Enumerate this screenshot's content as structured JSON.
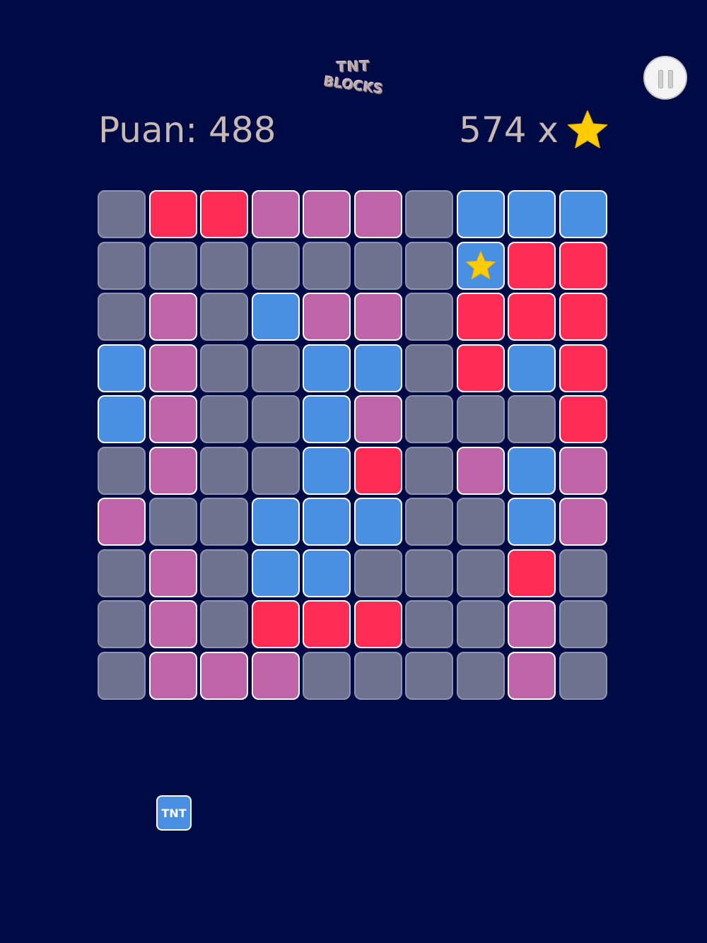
{
  "logo": {
    "line1": "TNT",
    "line2": "BLOCKS"
  },
  "score": {
    "label": "Puan: 488"
  },
  "stars": {
    "count_label": "574 x"
  },
  "board": {
    "rows": [
      [
        "gray",
        "red",
        "red",
        "purple",
        "purple",
        "purple",
        "gray",
        "blue",
        "blue",
        "blue"
      ],
      [
        "gray",
        "gray",
        "gray",
        "gray",
        "gray",
        "gray",
        "gray",
        "blue-star",
        "red",
        "red"
      ],
      [
        "gray",
        "purple",
        "gray",
        "blue",
        "purple",
        "purple",
        "gray",
        "red",
        "red",
        "red"
      ],
      [
        "blue",
        "purple",
        "gray",
        "gray",
        "blue",
        "blue",
        "gray",
        "red",
        "blue",
        "red"
      ],
      [
        "blue",
        "purple",
        "gray",
        "gray",
        "blue",
        "purple",
        "gray",
        "gray",
        "gray",
        "red"
      ],
      [
        "gray",
        "purple",
        "gray",
        "gray",
        "blue",
        "red",
        "gray",
        "purple",
        "blue",
        "purple"
      ],
      [
        "purple",
        "gray",
        "gray",
        "blue",
        "blue",
        "blue",
        "gray",
        "gray",
        "blue",
        "purple"
      ],
      [
        "gray",
        "purple",
        "gray",
        "blue",
        "blue",
        "gray",
        "gray",
        "gray",
        "red",
        "gray"
      ],
      [
        "gray",
        "purple",
        "gray",
        "red",
        "red",
        "red",
        "gray",
        "gray",
        "purple",
        "gray"
      ],
      [
        "gray",
        "purple",
        "purple",
        "purple",
        "gray",
        "gray",
        "gray",
        "gray",
        "purple",
        "gray"
      ]
    ]
  },
  "tnt": {
    "label": "TNT"
  },
  "colors": {
    "background": "#000b45",
    "red": "#ff2d55",
    "purple": "#c064aa",
    "blue": "#4a90e2",
    "gray": "#6e728f",
    "star": "#ffcc00"
  },
  "icons": {
    "pause": "pause-icon",
    "star": "star-icon"
  }
}
